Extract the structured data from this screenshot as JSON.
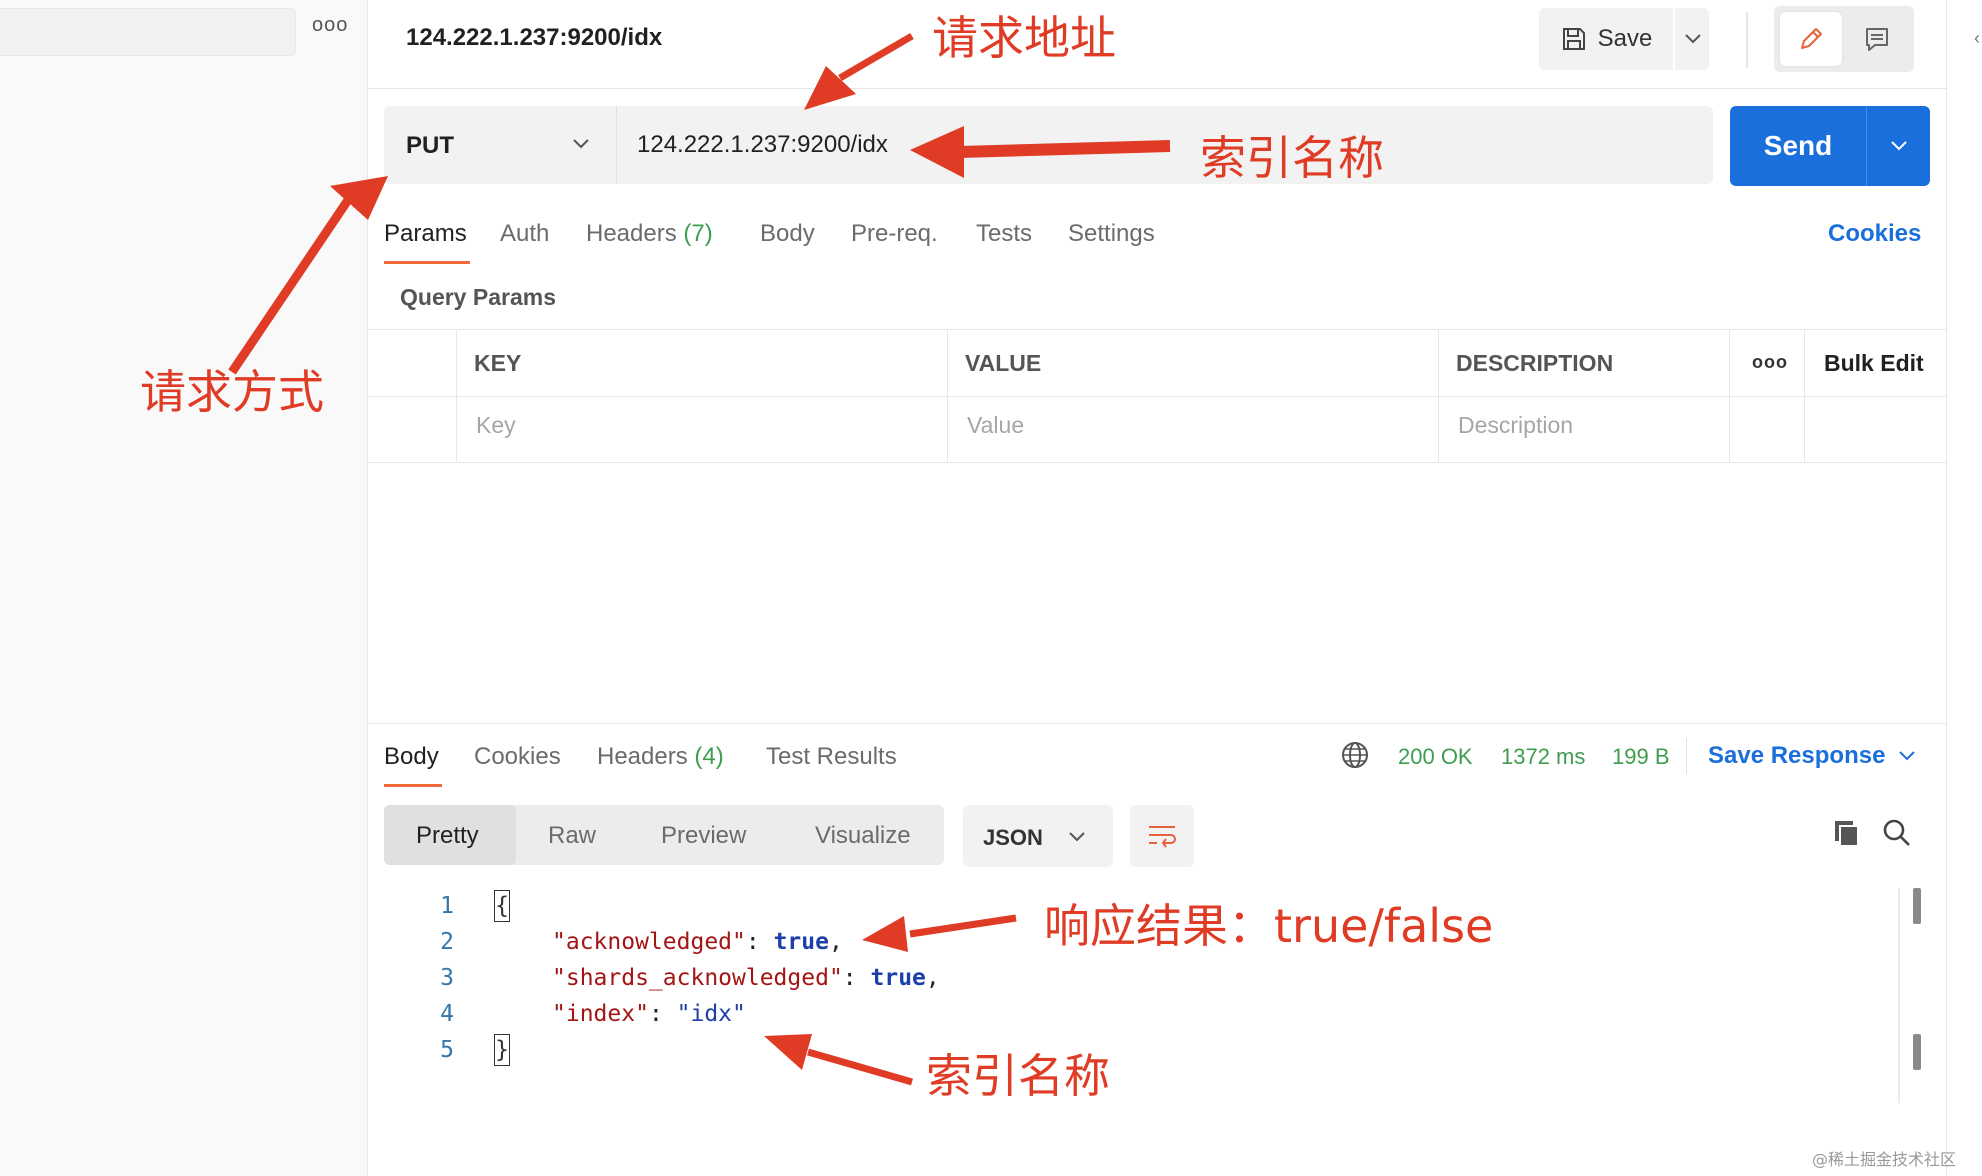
{
  "left_panel": {
    "more_label": "ooo"
  },
  "header": {
    "tab_title": "124.222.1.237:9200/idx",
    "save_label": "Save"
  },
  "request": {
    "method": "PUT",
    "url": "124.222.1.237:9200/idx",
    "send_label": "Send"
  },
  "request_tabs": [
    {
      "label": "Params",
      "count": ""
    },
    {
      "label": "Auth",
      "count": ""
    },
    {
      "label": "Headers",
      "count": "(7)"
    },
    {
      "label": "Body",
      "count": ""
    },
    {
      "label": "Pre-req.",
      "count": ""
    },
    {
      "label": "Tests",
      "count": ""
    },
    {
      "label": "Settings",
      "count": ""
    }
  ],
  "cookies_label": "Cookies",
  "query_params": {
    "title": "Query Params",
    "columns": [
      "KEY",
      "VALUE",
      "DESCRIPTION"
    ],
    "more_label": "ooo",
    "bulk_edit": "Bulk Edit",
    "placeholders": [
      "Key",
      "Value",
      "Description"
    ]
  },
  "response": {
    "tabs": [
      {
        "label": "Body",
        "count": ""
      },
      {
        "label": "Cookies",
        "count": ""
      },
      {
        "label": "Headers",
        "count": "(4)"
      },
      {
        "label": "Test Results",
        "count": ""
      }
    ],
    "status": "200 OK",
    "time": "1372 ms",
    "size": "199 B",
    "save_response": "Save Response",
    "view_modes": [
      "Pretty",
      "Raw",
      "Preview",
      "Visualize"
    ],
    "format": "JSON",
    "code": {
      "line_numbers": [
        "1",
        "2",
        "3",
        "4",
        "5"
      ],
      "open_brace": "{",
      "close_brace": "}",
      "lines": [
        {
          "key": "\"acknowledged\"",
          "sep": ": ",
          "value": "true",
          "trail": ","
        },
        {
          "key": "\"shards_acknowledged\"",
          "sep": ": ",
          "value": "true",
          "trail": ","
        },
        {
          "key": "\"index\"",
          "sep": ": ",
          "value": "\"idx\"",
          "trail": ""
        }
      ]
    }
  },
  "annotations": {
    "request_address": "请求地址",
    "index_name_url": "索引名称",
    "request_method": "请求方式",
    "response_result": "响应结果：true/false",
    "index_name_result": "索引名称",
    "color": "#e03b24"
  },
  "watermark": "@稀土掘金技术社区",
  "colors": {
    "accent_orange": "#f26b3a",
    "send_blue": "#1a6fdc",
    "status_green": "#3f9d4f"
  }
}
